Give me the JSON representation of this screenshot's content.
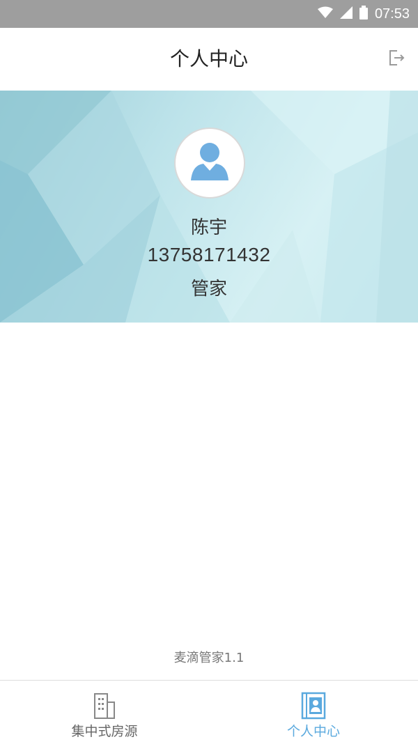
{
  "status_bar": {
    "time": "07:53",
    "icons": [
      "wifi-icon",
      "signal-icon",
      "battery-icon"
    ]
  },
  "header": {
    "title": "个人中心",
    "logout_icon": "logout-icon"
  },
  "profile": {
    "avatar_icon": "user-avatar-icon",
    "name": "陈宇",
    "phone": "13758171432",
    "role": "管家"
  },
  "footer": {
    "version": "麦滴管家1.1"
  },
  "tabs": [
    {
      "label": "集中式房源",
      "icon": "building-icon",
      "active": false
    },
    {
      "label": "个人中心",
      "icon": "contacts-book-icon",
      "active": true
    }
  ],
  "colors": {
    "accent": "#5aa9de",
    "status_bar": "#9e9e9e",
    "banner": "#bde3ea"
  }
}
